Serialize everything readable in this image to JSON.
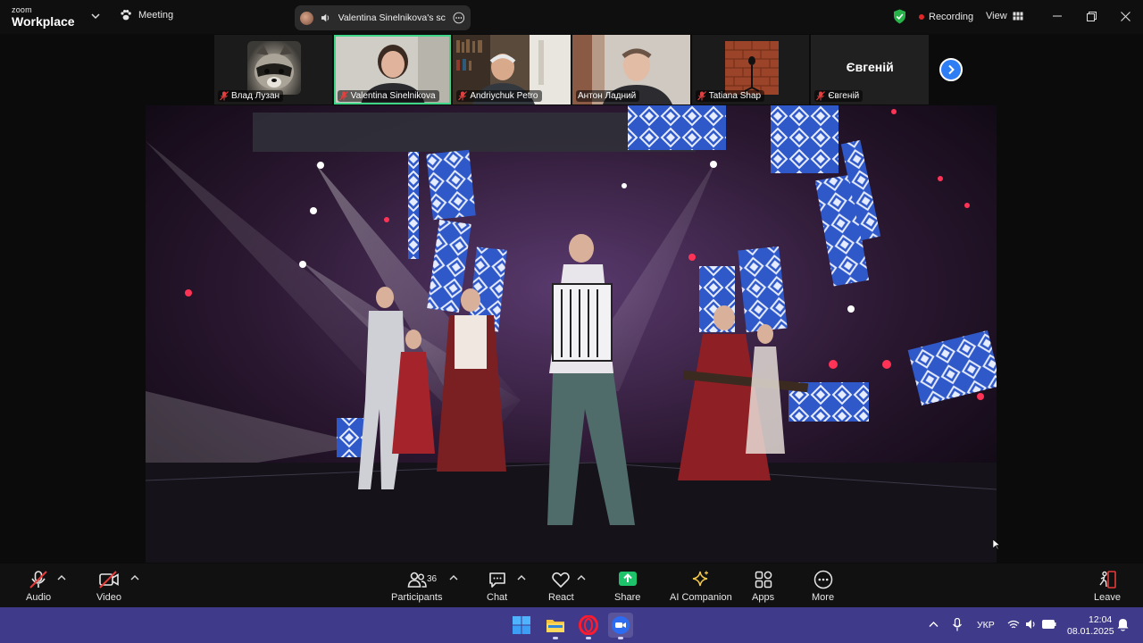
{
  "titlebar": {
    "brand_small": "zoom",
    "brand_big": "Workplace",
    "meeting_label": "Meeting",
    "share_label": "Valentina Sinelnikova's screen",
    "recording_label": "Recording",
    "view_label": "View"
  },
  "participants": [
    {
      "name": "Влад Лузан",
      "muted": true,
      "style": "raccoon"
    },
    {
      "name": "Valentina Sinelnikova",
      "muted": true,
      "style": "video",
      "active": true
    },
    {
      "name": "Andriychuk Petro",
      "muted": true,
      "style": "video"
    },
    {
      "name": "Антон Ладний",
      "muted": false,
      "style": "video"
    },
    {
      "name": "Tatiana Shap",
      "muted": true,
      "style": "brick"
    },
    {
      "name": "Євгеній",
      "muted": true,
      "style": "initial",
      "initial": "Євгеній"
    }
  ],
  "toolbar": {
    "audio": "Audio",
    "video": "Video",
    "participants": "Participants",
    "participants_count": "36",
    "chat": "Chat",
    "react": "React",
    "share": "Share",
    "ai": "AI Companion",
    "apps": "Apps",
    "more": "More",
    "leave": "Leave"
  },
  "taskbar": {
    "lang": "УКР",
    "time": "12:04",
    "date": "08.01.2025"
  },
  "colors": {
    "active_border": "#3fd68a",
    "share_green": "#1ec26b",
    "record_red": "#e02828",
    "taskbar": "#3f3a8a",
    "accent_blue": "#2d7df5"
  }
}
